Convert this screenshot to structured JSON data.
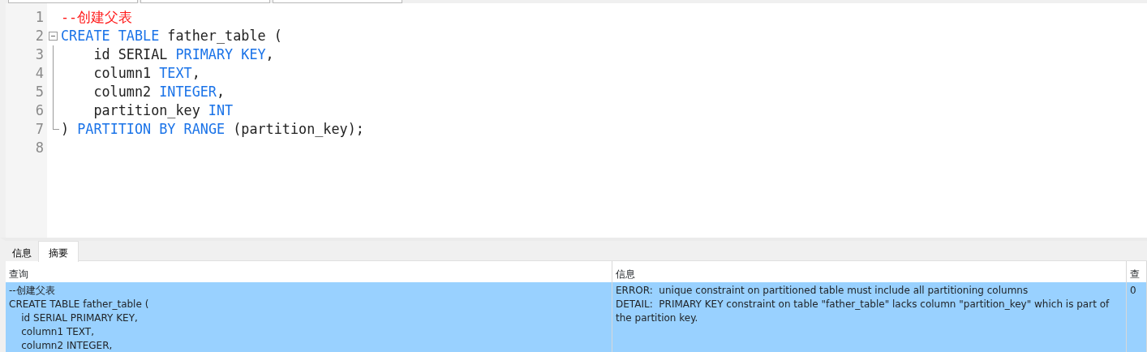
{
  "editor": {
    "lines": [
      {
        "number": "1",
        "kind": "plain",
        "tokens": [
          {
            "kind": "comment",
            "text": "--创建父表"
          }
        ]
      },
      {
        "number": "2",
        "kind": "fold_start",
        "tokens": [
          {
            "kind": "keyword",
            "text": "CREATE"
          },
          {
            "kind": "keyword",
            "text": " TABLE"
          },
          {
            "kind": "plain",
            "text": " father_table ("
          }
        ]
      },
      {
        "number": "3",
        "kind": "fold_body",
        "tokens": [
          {
            "kind": "plain",
            "text": "    id SERIAL "
          },
          {
            "kind": "keyword",
            "text": "PRIMARY"
          },
          {
            "kind": "keyword",
            "text": " KEY"
          },
          {
            "kind": "plain",
            "text": ","
          }
        ]
      },
      {
        "number": "4",
        "kind": "fold_body",
        "tokens": [
          {
            "kind": "plain",
            "text": "    column1 "
          },
          {
            "kind": "keyword",
            "text": "TEXT"
          },
          {
            "kind": "plain",
            "text": ","
          }
        ]
      },
      {
        "number": "5",
        "kind": "fold_body",
        "tokens": [
          {
            "kind": "plain",
            "text": "    column2 "
          },
          {
            "kind": "keyword",
            "text": "INTEGER"
          },
          {
            "kind": "plain",
            "text": ","
          }
        ]
      },
      {
        "number": "6",
        "kind": "fold_body",
        "tokens": [
          {
            "kind": "plain",
            "text": "    partition_key "
          },
          {
            "kind": "keyword",
            "text": "INT"
          }
        ]
      },
      {
        "number": "7",
        "kind": "fold_end",
        "tokens": [
          {
            "kind": "plain",
            "text": ") "
          },
          {
            "kind": "keyword",
            "text": "PARTITION"
          },
          {
            "kind": "keyword",
            "text": " BY"
          },
          {
            "kind": "keyword",
            "text": " RANGE"
          },
          {
            "kind": "plain",
            "text": " (partition_key);"
          }
        ]
      },
      {
        "number": "8",
        "kind": "plain"
      }
    ]
  },
  "result_tabs": [
    {
      "label": "信息",
      "selected": false
    },
    {
      "label": "摘要",
      "selected": true
    }
  ],
  "table": {
    "columns": [
      "查询",
      "信息",
      "查"
    ],
    "rows": [
      {
        "selected": true,
        "cells": [
          "--创建父表\nCREATE TABLE father_table (\n    id SERIAL PRIMARY KEY,\n    column1 TEXT,\n    column2 INTEGER,",
          "ERROR:  unique constraint on partitioned table must include all partitioning columns\nDETAIL:  PRIMARY KEY constraint on table \"father_table\" lacks column \"partition_key\" which is part of the partition key.",
          "0"
        ]
      }
    ]
  }
}
